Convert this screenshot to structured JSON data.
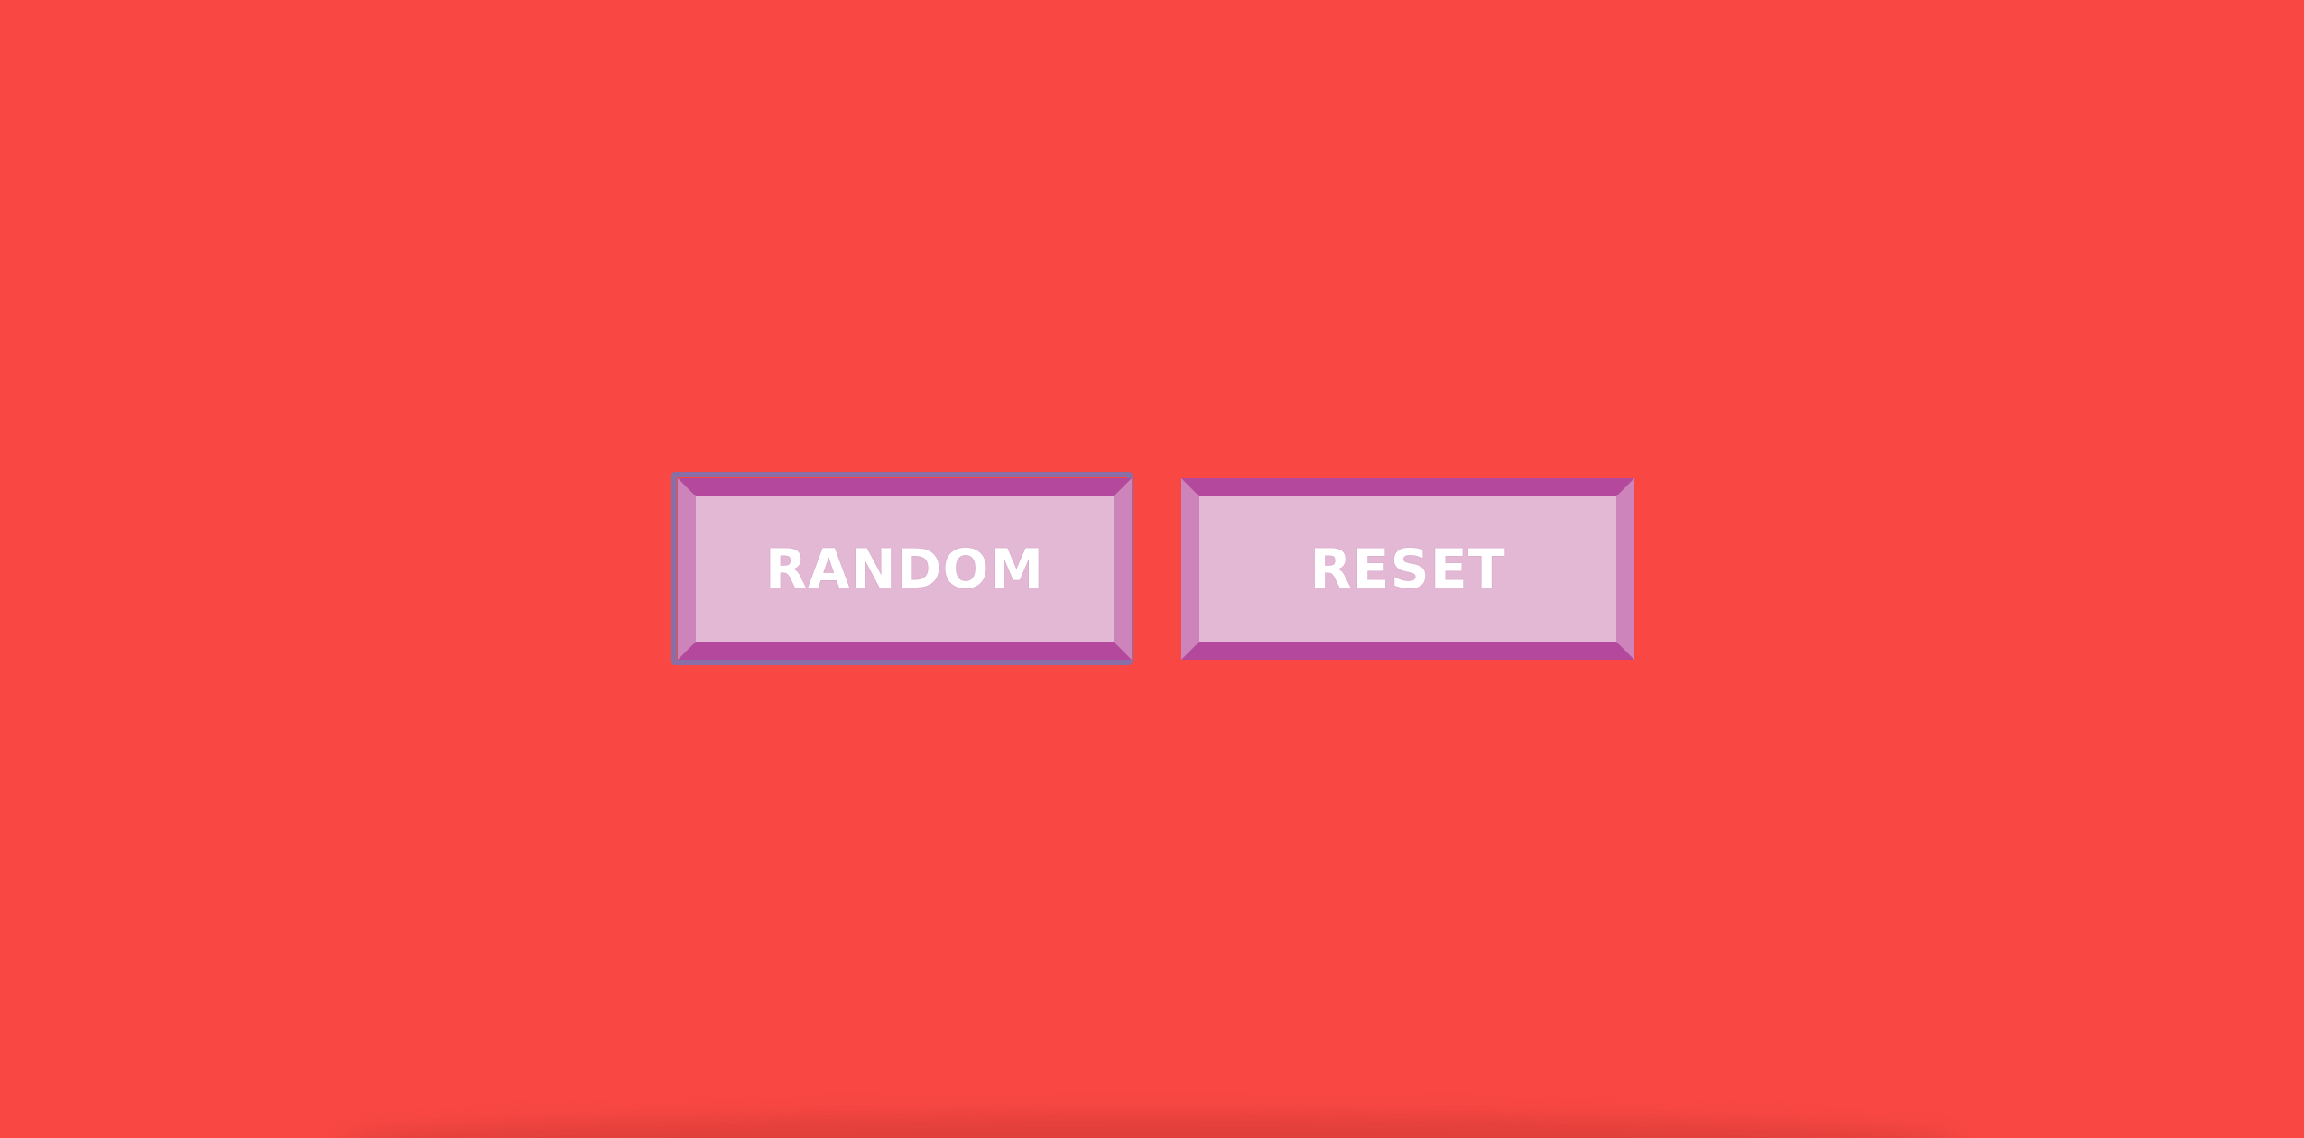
{
  "colors": {
    "background": "#f94843",
    "button_face": "#e3b8d5",
    "bevel_top": "#b3489c",
    "bevel_bottom": "#b3489c",
    "bevel_left": "#cd84ba",
    "bevel_right": "#cd84ba",
    "focus_ring": "#8a6fa6"
  },
  "buttons": {
    "random_label": "RANDOM",
    "reset_label": "RESET"
  },
  "focused_button": "random"
}
